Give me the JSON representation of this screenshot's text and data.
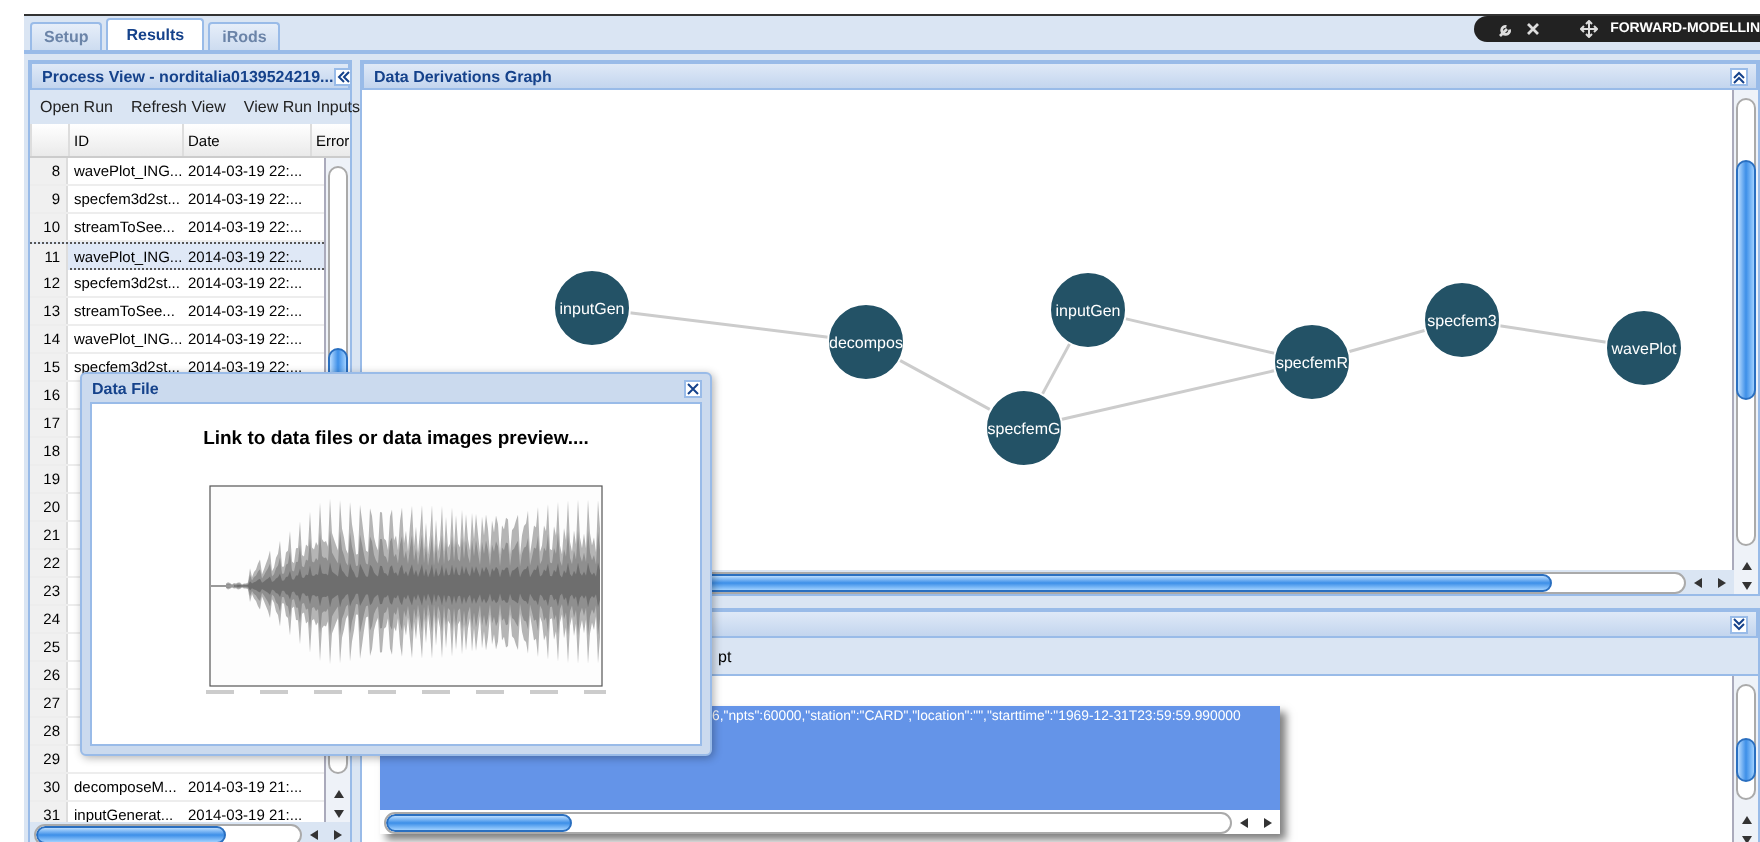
{
  "top_tabs": [
    {
      "label": "Setup",
      "selected": false
    },
    {
      "label": "Results",
      "selected": true
    },
    {
      "label": "iRods",
      "selected": false
    }
  ],
  "top_badge": {
    "title": "FORWARD-MODELLIN"
  },
  "process_view": {
    "title": "Process View - norditalia0139524219...",
    "toolbar": [
      "Open Run",
      "Refresh View",
      "View Run Inputs"
    ],
    "columns": [
      "ID",
      "Date",
      "Error"
    ],
    "rows": [
      {
        "number": "8",
        "id": "wavePlot_ING...",
        "date": "2014-03-19 22:...",
        "selected": false
      },
      {
        "number": "9",
        "id": "specfem3d2st...",
        "date": "2014-03-19 22:...",
        "selected": false
      },
      {
        "number": "10",
        "id": "streamToSee...",
        "date": "2014-03-19 22:...",
        "selected": false
      },
      {
        "number": "11",
        "id": "wavePlot_ING...",
        "date": "2014-03-19 22:...",
        "selected": true
      },
      {
        "number": "12",
        "id": "specfem3d2st...",
        "date": "2014-03-19 22:...",
        "selected": false
      },
      {
        "number": "13",
        "id": "streamToSee...",
        "date": "2014-03-19 22:...",
        "selected": false
      },
      {
        "number": "14",
        "id": "wavePlot_ING...",
        "date": "2014-03-19 22:...",
        "selected": false
      },
      {
        "number": "15",
        "id": "specfem3d2st...",
        "date": "2014-03-19 22:...",
        "selected": false
      },
      {
        "number": "16",
        "selected": false
      },
      {
        "number": "17",
        "selected": false
      },
      {
        "number": "18",
        "selected": false
      },
      {
        "number": "19",
        "selected": false
      },
      {
        "number": "20",
        "selected": false
      },
      {
        "number": "21",
        "selected": false
      },
      {
        "number": "22",
        "selected": false
      },
      {
        "number": "23",
        "selected": false
      },
      {
        "number": "24",
        "selected": false
      },
      {
        "number": "25",
        "selected": false
      },
      {
        "number": "26",
        "selected": false
      },
      {
        "number": "27",
        "selected": false
      },
      {
        "number": "28",
        "selected": false
      },
      {
        "number": "29",
        "selected": false
      },
      {
        "number": "30",
        "id": "decomposeM...",
        "date": "2014-03-19 21:...",
        "selected": false
      },
      {
        "number": "31",
        "id": "inputGenerat...",
        "date": "2014-03-19 21:...",
        "selected": false
      }
    ]
  },
  "graph": {
    "title": "Data Derivations Graph",
    "nodes": [
      {
        "label": "inputGen"
      },
      {
        "label": "decompos"
      },
      {
        "label": "inputGen"
      },
      {
        "label": "specfemG"
      },
      {
        "label": "specfemR"
      },
      {
        "label": "specfem3"
      },
      {
        "label": "wavePlot"
      }
    ]
  },
  "output_panel": {
    "toolbar_text": "pt",
    "output": "6,\"npts\":60000,\"station\":\"CARD\",\"location\":\"\",\"starttime\":\"1969-12-31T23:59:59.990000"
  },
  "dialog": {
    "title": "Data File",
    "heading": "Link to data files or data images preview...."
  }
}
